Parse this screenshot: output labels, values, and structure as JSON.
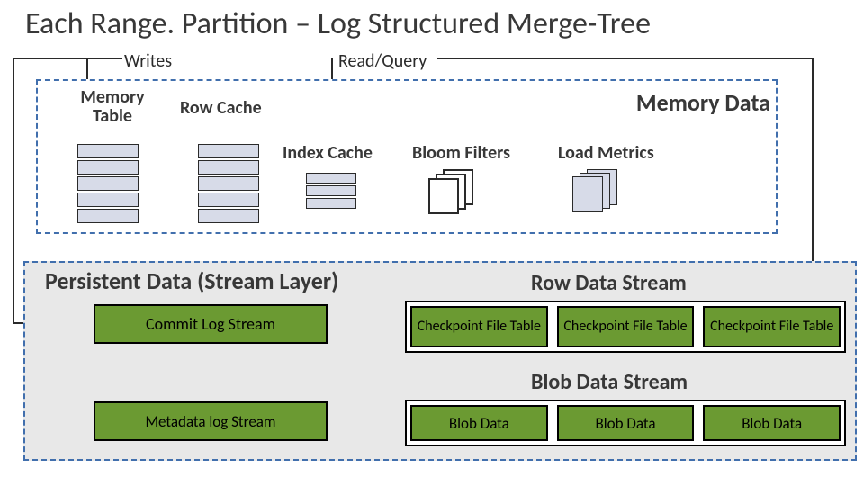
{
  "title": "Each Range. Partition – Log Structured Merge-Tree",
  "labels": {
    "writes": "Writes",
    "read_query": "Read/Query",
    "memory_data": "Memory Data",
    "memory_table": "Memory Table",
    "row_cache": "Row Cache",
    "index_cache": "Index Cache",
    "bloom_filters": "Bloom Filters",
    "load_metrics": "Load Metrics",
    "persistent_title": "Persistent Data (Stream Layer)",
    "row_data_stream": "Row Data Stream",
    "blob_data_stream": "Blob Data Stream",
    "commit_log": "Commit Log Stream",
    "metadata_log": "Metadata log Stream",
    "checkpoint": "Checkpoint File Table",
    "blob_data": "Blob Data"
  }
}
